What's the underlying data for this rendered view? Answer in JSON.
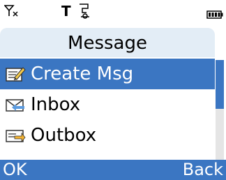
{
  "status": {
    "signal_icon": "no-signal-icon",
    "t_label": "T",
    "download_icon": "java-download-icon",
    "battery_icon": "battery-icon"
  },
  "header": {
    "title": "Message"
  },
  "menu": {
    "items": [
      {
        "label": "Create Msg",
        "icon": "create-message-icon",
        "selected": true
      },
      {
        "label": "Inbox",
        "icon": "inbox-icon",
        "selected": false
      },
      {
        "label": "Outbox",
        "icon": "outbox-icon",
        "selected": false
      }
    ]
  },
  "softkeys": {
    "left": "OK",
    "right": "Back"
  },
  "colors": {
    "accent": "#3b76c2",
    "title_bg": "#e3edf6"
  }
}
